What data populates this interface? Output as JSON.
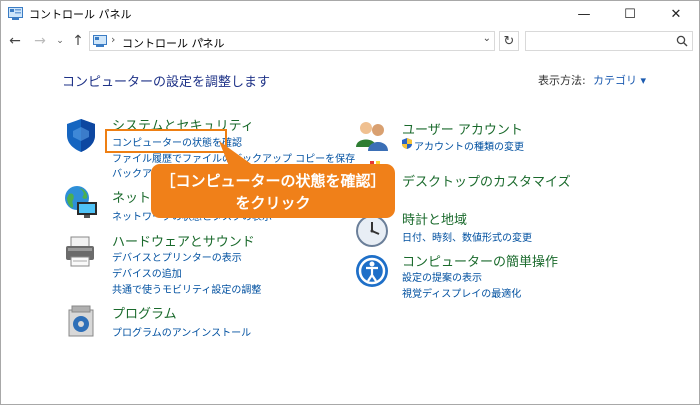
{
  "window": {
    "title": "コントロール パネル",
    "min": "—",
    "max": "☐",
    "close": "✕"
  },
  "nav": {
    "back": "←",
    "forward": "→",
    "recent": "⌄",
    "up": "↑",
    "address_sep": "›",
    "address": "コントロール パネル",
    "address_sep2": "›",
    "dropdown": "⌄",
    "refresh": "↻",
    "search_placeholder": ""
  },
  "heading": "コンピューターの設定を調整します",
  "view_by_label": "表示方法:",
  "view_by_value": "カテゴリ ▾",
  "categories": [
    {
      "title": "システムとセキュリティ",
      "links": [
        "コンピューターの状態を確認",
        "ファイル履歴でファイルのバックアップ コピーを保存",
        "バックアップと復元"
      ]
    },
    {
      "title": "ネットワークとインターネット",
      "links": [
        "ネットワークの状態とタスクの表示"
      ]
    },
    {
      "title": "ハードウェアとサウンド",
      "links": [
        "デバイスとプリンターの表示",
        "デバイスの追加",
        "共通で使うモビリティ設定の調整"
      ]
    },
    {
      "title": "プログラム",
      "links": [
        "プログラムのアンインストール"
      ]
    },
    {
      "title": "ユーザー アカウント",
      "links": [
        "アカウントの種類の変更"
      ]
    },
    {
      "title": "デスクトップのカスタマイズ",
      "links": []
    },
    {
      "title": "時計と地域",
      "links": [
        "日付、時刻、数値形式の変更"
      ]
    },
    {
      "title": "コンピューターの簡単操作",
      "links": [
        "設定の提案の表示",
        "視覚ディスプレイの最適化"
      ]
    }
  ],
  "callout": {
    "line1": "［コンピューターの状態を確認］",
    "line2": "をクリック"
  },
  "colors": {
    "heading": "#1e3287",
    "category_title": "#1a6a2c",
    "link": "#0050a0",
    "callout": "#f08019"
  }
}
